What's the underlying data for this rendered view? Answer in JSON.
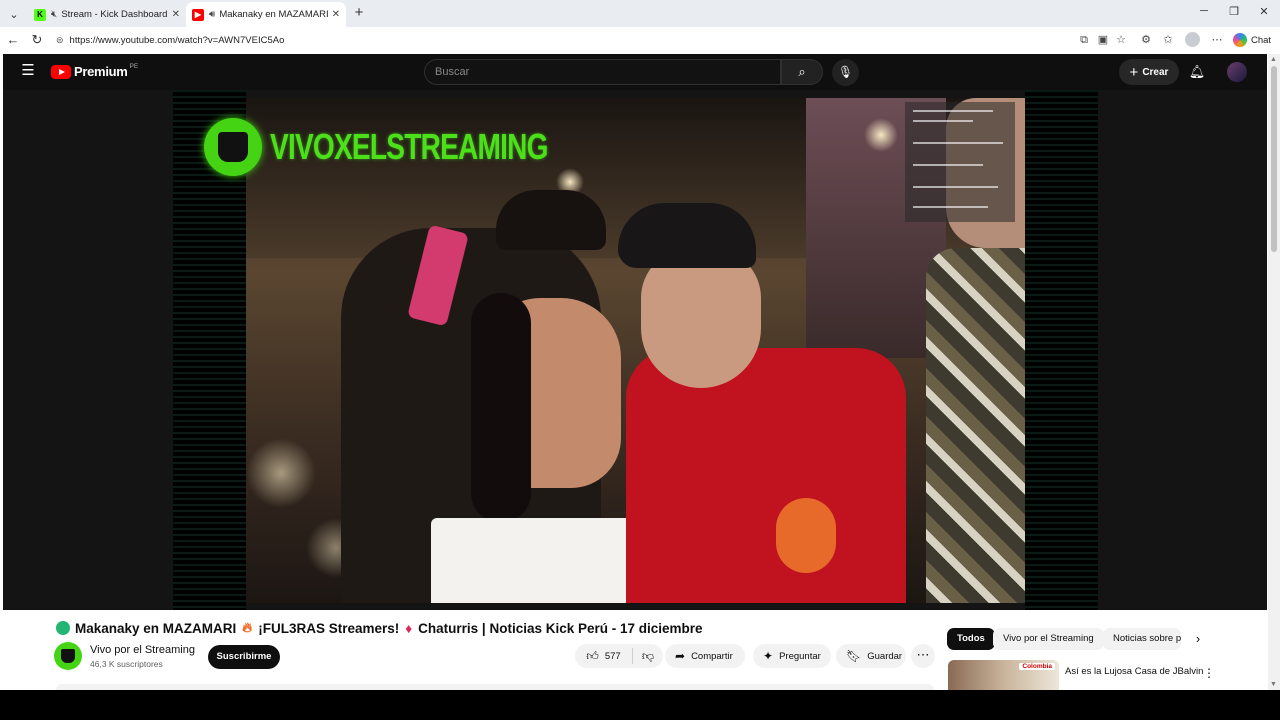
{
  "browser": {
    "tabs": [
      {
        "title": "Stream - Kick Dashboard",
        "favicon": "kick-icon",
        "muted_icon": "speaker-muted-icon"
      },
      {
        "title": "Makanaky en MAZAMARI",
        "favicon": "youtube-icon",
        "audio_icon": "speaker-icon",
        "active": true
      }
    ],
    "url": "https://www.youtube.com/watch?v=AWN7VEIC5Ao",
    "chat_label": "Chat"
  },
  "youtube": {
    "logo_text": "Premium",
    "country_code": "PE",
    "search_placeholder": "Buscar",
    "create_label": "Crear",
    "accent": "#ff0000"
  },
  "video": {
    "overlay_brand": "VIVOXELSTREAMING",
    "brand_color": "#45d414",
    "title_parts": [
      "Makanaky en MAZAMARI",
      "¡FUL3RAS Streamers!",
      "Chaturris | Noticias Kick Perú - 17 diciembre"
    ],
    "channel_name": "Vivo por el Streaming",
    "subscribers": "46,3 K suscriptores",
    "subscribe_label": "Suscribirme",
    "likes": "577",
    "share_label": "Compartir",
    "ask_label": "Preguntar",
    "save_label": "Guardar"
  },
  "sidebar": {
    "chips": [
      "Todos",
      "Vivo por el Streaming",
      "Noticias sobre p"
    ],
    "recommendation": {
      "title": "Así es la Lujosa Casa de JBalvin",
      "thumb_badge": "Colombia"
    }
  }
}
